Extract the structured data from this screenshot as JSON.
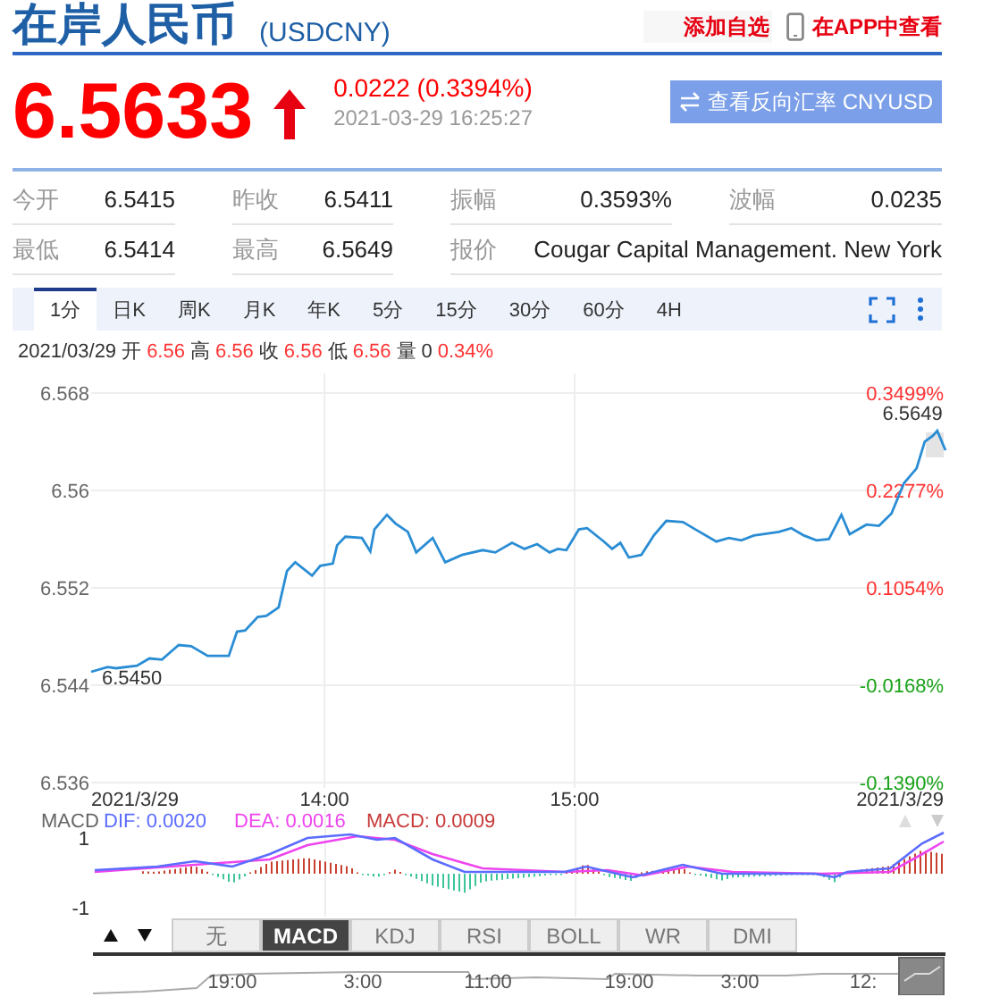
{
  "header": {
    "title": "在岸人民币",
    "code": "(USDCNY)",
    "actions": [
      {
        "kind": "text",
        "label": "添加自选"
      },
      {
        "kind": "phone",
        "label": "在APP中查看"
      }
    ]
  },
  "quote": {
    "price": "6.5633",
    "change": "0.0222 (0.3394%)",
    "time": "2021-03-29 16:25:27",
    "reverse_button": "查看反向汇率 CNYUSD"
  },
  "stats": [
    [
      {
        "label": "今开",
        "value": "6.5415"
      },
      {
        "label": "昨收",
        "value": "6.5411"
      },
      {
        "label": "振幅",
        "value": "0.3593%"
      },
      {
        "label": "波幅",
        "value": "0.0235"
      }
    ],
    [
      {
        "label": "最低",
        "value": "6.5414"
      },
      {
        "label": "最高",
        "value": "6.5649"
      },
      {
        "label": "报价",
        "value": "Cougar Capital Management. New York"
      }
    ]
  ],
  "period_tabs": [
    {
      "label": "1分",
      "selected": true
    },
    {
      "label": "日K",
      "selected": false
    },
    {
      "label": "周K",
      "selected": false
    },
    {
      "label": "月K",
      "selected": false
    },
    {
      "label": "年K",
      "selected": false
    },
    {
      "label": "5分",
      "selected": false
    },
    {
      "label": "15分",
      "selected": false
    },
    {
      "label": "30分",
      "selected": false
    },
    {
      "label": "60分",
      "selected": false
    },
    {
      "label": "4H",
      "selected": false
    }
  ],
  "ohlc": {
    "date": "2021/03/29",
    "fields": [
      {
        "label": "开",
        "value": "6.56"
      },
      {
        "label": "高",
        "value": "6.56"
      },
      {
        "label": "收",
        "value": "6.56"
      },
      {
        "label": "低",
        "value": "6.56"
      }
    ],
    "volume": {
      "label": "量",
      "value": "0"
    },
    "change": "0.34%"
  },
  "price_chart": {
    "right_axis_labels": [
      {
        "text": "0.3499%",
        "color": "#ff3333"
      },
      {
        "text": "0.2277%",
        "color": "#ff3333"
      },
      {
        "text": "0.1054%",
        "color": "#ff3333"
      },
      {
        "text": "-0.0168%",
        "color": "#1aa31a"
      },
      {
        "text": "-0.1390%",
        "color": "#1aa31a"
      }
    ],
    "chart_data": {
      "type": "line",
      "grid": true,
      "x": [
        13.067,
        13.133,
        13.167,
        13.25,
        13.3,
        13.35,
        13.383,
        13.417,
        13.467,
        13.533,
        13.617,
        13.65,
        13.683,
        13.733,
        13.767,
        13.817,
        13.85,
        13.883,
        13.95,
        13.983,
        14.033,
        14.05,
        14.083,
        14.15,
        14.183,
        14.2,
        14.25,
        14.283,
        14.333,
        14.367,
        14.433,
        14.483,
        14.55,
        14.633,
        14.683,
        14.75,
        14.8,
        14.85,
        14.9,
        14.933,
        14.967,
        15.017,
        15.05,
        15.117,
        15.15,
        15.183,
        15.217,
        15.267,
        15.317,
        15.367,
        15.433,
        15.483,
        15.567,
        15.617,
        15.667,
        15.717,
        15.817,
        15.867,
        15.917,
        15.967,
        16.017,
        16.067,
        16.1,
        16.167,
        16.217,
        16.267,
        16.317,
        16.367,
        16.4,
        16.433,
        16.45,
        16.483
      ],
      "series": [
        {
          "color": "#2a8dd4",
          "values": [
            6.5451,
            6.5455,
            6.5454,
            6.5456,
            6.5462,
            6.5461,
            6.5467,
            6.5473,
            6.5472,
            6.5464,
            6.5464,
            6.5484,
            6.5485,
            6.5496,
            6.5497,
            6.5504,
            6.5534,
            6.5541,
            6.553,
            6.5538,
            6.554,
            6.5555,
            6.5562,
            6.5561,
            6.555,
            6.5568,
            6.558,
            6.5573,
            6.5566,
            6.5549,
            6.5561,
            6.5541,
            6.5547,
            6.5551,
            6.5549,
            6.5557,
            6.5552,
            6.5556,
            6.5549,
            6.5552,
            6.5551,
            6.5568,
            6.5569,
            6.5558,
            6.5552,
            6.5557,
            6.5545,
            6.5547,
            6.5563,
            6.5575,
            6.5574,
            6.5568,
            6.5558,
            6.5561,
            6.5559,
            6.5563,
            6.5566,
            6.5569,
            6.5563,
            6.5559,
            6.556,
            6.558,
            6.5564,
            6.5572,
            6.5571,
            6.5581,
            6.5606,
            6.5618,
            6.564,
            6.5645,
            6.5649,
            6.5633
          ]
        }
      ],
      "xlim": [
        13.067,
        16.483
      ],
      "ylim": [
        6.536,
        6.568
      ],
      "xticks": [
        {
          "value": 13.067,
          "label": "2021/3/29"
        },
        {
          "value": 14,
          "label": "14:00"
        },
        {
          "value": 15,
          "label": "15:00"
        },
        {
          "value": 16.483,
          "label": "2021/3/29"
        }
      ],
      "yticks": [
        6.568,
        6.56,
        6.552,
        6.544,
        6.536
      ],
      "annotations": [
        {
          "x": 13.067,
          "y": 6.5451,
          "text": "6.5450"
        },
        {
          "x": 16.45,
          "y": 6.5649,
          "text": "6.5649"
        }
      ]
    }
  },
  "macd": {
    "title": "MACD",
    "legend": [
      {
        "text": "DIF: 0.0020",
        "color": "#5b6cff"
      },
      {
        "text": "DEA: 0.0016",
        "color": "#ee44ee"
      },
      {
        "text": "MACD: 0.0009",
        "color": "#c83a3a"
      }
    ],
    "axis": [
      "1",
      "-1"
    ]
  },
  "indicator_tabs": [
    {
      "label": "无",
      "selected": false
    },
    {
      "label": "MACD",
      "selected": true
    },
    {
      "label": "KDJ",
      "selected": false
    },
    {
      "label": "RSI",
      "selected": false
    },
    {
      "label": "BOLL",
      "selected": false
    },
    {
      "label": "WR",
      "selected": false
    },
    {
      "label": "DMI",
      "selected": false
    }
  ],
  "navigator": {
    "labels": [
      "19:00",
      "3:00",
      "11:00",
      "19:00",
      "3:00",
      "12:"
    ]
  }
}
